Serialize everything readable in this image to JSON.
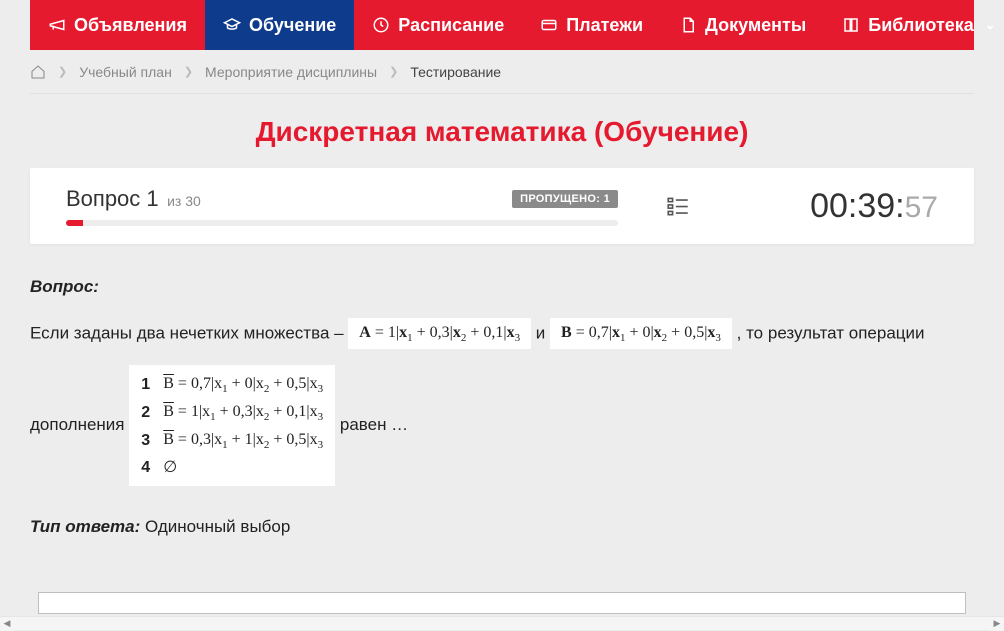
{
  "nav": {
    "items": [
      {
        "label": "Объявления",
        "icon": "megaphone-icon"
      },
      {
        "label": "Обучение",
        "icon": "graduation-cap-icon",
        "active": true
      },
      {
        "label": "Расписание",
        "icon": "clock-icon"
      },
      {
        "label": "Платежи",
        "icon": "card-icon"
      },
      {
        "label": "Документы",
        "icon": "document-icon"
      },
      {
        "label": "Библиотека",
        "icon": "book-icon",
        "chevron": true
      }
    ]
  },
  "breadcrumb": {
    "items": [
      {
        "label": "Учебный план"
      },
      {
        "label": "Мероприятие дисциплины"
      }
    ],
    "current": "Тестирование"
  },
  "page_title": "Дискретная математика (Обучение)",
  "question_panel": {
    "label": "Вопрос 1",
    "total": "из 30",
    "skip_badge": "ПРОПУЩЕНО: 1",
    "progress_percent": 3
  },
  "timer": {
    "mm": "00:39:",
    "ss": "57"
  },
  "question": {
    "heading": "Вопрос:",
    "text_before_A": "Если заданы два нечетких множества – ",
    "formula_A": "A = 1|x₁ + 0,3|x₂ + 0,1|x₃",
    "text_between": "и",
    "formula_B": "B = 0,7|x₁ + 0|x₂ + 0,5|x₃",
    "text_after_B": ", то результат операции",
    "text_before_options": "дополнения",
    "text_after_options": " равен …"
  },
  "options": [
    {
      "n": "1",
      "expr": "B̄ = 0,7|x₁ + 0|x₂ + 0,5|x₃"
    },
    {
      "n": "2",
      "expr": "B̄ = 1|x₁ + 0,3|x₂ + 0,1|x₃"
    },
    {
      "n": "3",
      "expr": "B̄ = 0,3|x₁ + 1|x₂ + 0,5|x₃"
    },
    {
      "n": "4",
      "expr": "∅"
    }
  ],
  "answer_type": {
    "label": "Тип ответа:",
    "value": " Одиночный выбор"
  }
}
